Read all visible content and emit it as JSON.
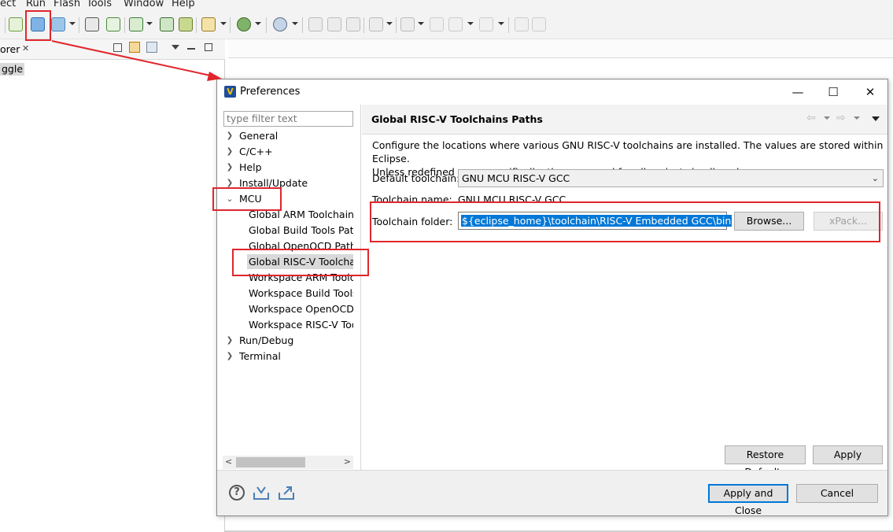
{
  "menubar": [
    "ect",
    "Run",
    "Flash",
    "Tools",
    "Window",
    "Help"
  ],
  "explorer": {
    "tab": "orer",
    "item": "ggle"
  },
  "dialog": {
    "title": "Preferences",
    "filter_placeholder": "type filter text",
    "tree": [
      {
        "label": "General",
        "level": 0,
        "expander": "collapsed"
      },
      {
        "label": "C/C++",
        "level": 0,
        "expander": "collapsed"
      },
      {
        "label": "Help",
        "level": 0,
        "expander": "collapsed"
      },
      {
        "label": "Install/Update",
        "level": 0,
        "expander": "collapsed"
      },
      {
        "label": "MCU",
        "level": 0,
        "expander": "expanded"
      },
      {
        "label": "Global ARM Toolchains Paths",
        "level": 1
      },
      {
        "label": "Global Build Tools Paths",
        "level": 1
      },
      {
        "label": "Global OpenOCD Path",
        "level": 1
      },
      {
        "label": "Global RISC-V Toolchains Paths",
        "level": 1,
        "selected": true
      },
      {
        "label": "Workspace ARM Toolchains Paths",
        "level": 1
      },
      {
        "label": "Workspace Build Tools Path",
        "level": 1
      },
      {
        "label": "Workspace OpenOCD Path",
        "level": 1
      },
      {
        "label": "Workspace RISC-V Toolchains Paths",
        "level": 1
      },
      {
        "label": "Run/Debug",
        "level": 0,
        "expander": "collapsed"
      },
      {
        "label": "Terminal",
        "level": 0,
        "expander": "collapsed"
      }
    ],
    "page": {
      "title": "Global RISC-V Toolchains Paths",
      "description_line1": "Configure the locations where various GNU RISC-V toolchains are installed. The values are stored within Eclipse.",
      "description_line2": "Unless redefined more specifically, they are used for all projects in all workspaces.",
      "default_toolchain_label": "Default toolchain:",
      "default_toolchain_value": "GNU MCU RISC-V GCC",
      "toolchain_name_label": "Toolchain name:",
      "toolchain_name_value": "GNU MCU RISC-V GCC",
      "toolchain_folder_label": "Toolchain folder:",
      "toolchain_folder_value": "${eclipse_home}\\toolchain\\RISC-V Embedded GCC\\bin",
      "browse_label": "Browse...",
      "xpack_label": "xPack..."
    },
    "restore_defaults_label": "Restore Defaults",
    "apply_label": "Apply",
    "apply_close_label": "Apply and Close",
    "cancel_label": "Cancel"
  },
  "colors": {
    "selection": "#0078d7",
    "highlight_boxes": "#e0262d"
  }
}
